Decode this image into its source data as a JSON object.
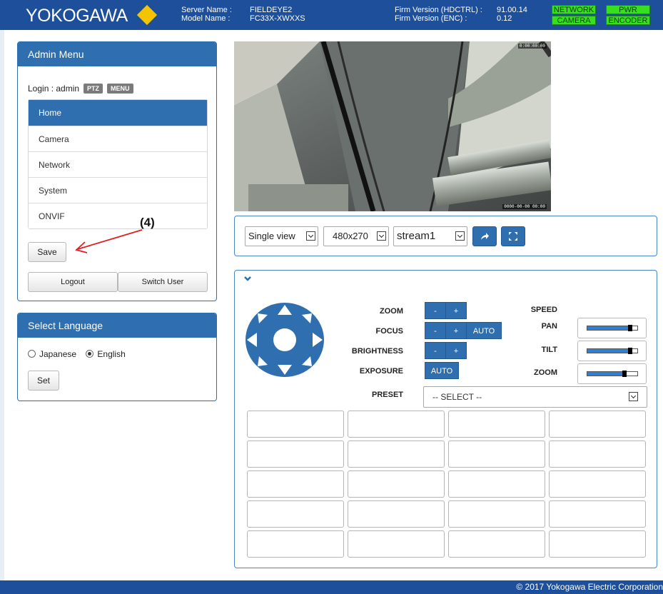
{
  "header": {
    "brand": "YOKOGAWA",
    "server_name_label": "Server Name :",
    "server_name": "FIELDEYE2",
    "model_name_label": "Model Name :",
    "model_name": "FC33X-XWXXS",
    "firm_hdctrl_label": "Firm Version (HDCTRL) :",
    "firm_hdctrl": "91.00.14",
    "firm_enc_label": "Firm Version (ENC) :",
    "firm_enc": "0.12",
    "status_leds": [
      "NETWORK",
      "PWR",
      "CAMERA",
      "ENCODER"
    ],
    "led_color": "#37e01f"
  },
  "admin_menu": {
    "title": "Admin Menu",
    "login_text": "Login : admin",
    "tags": [
      "PTZ",
      "MENU"
    ],
    "nav": [
      {
        "label": "Home",
        "active": true
      },
      {
        "label": "Camera"
      },
      {
        "label": "Network"
      },
      {
        "label": "System"
      },
      {
        "label": "ONVIF"
      }
    ],
    "save_label": "Save",
    "logout_label": "Logout",
    "switch_user_label": "Switch User"
  },
  "annotation": {
    "label": "(4)",
    "color": "#e02020"
  },
  "language": {
    "title": "Select Language",
    "options": [
      "Japanese",
      "English"
    ],
    "selected": "English",
    "set_label": "Set"
  },
  "video": {
    "timestamp_top": "0:00:00:00",
    "timestamp_bottom": "0000-00-00 00:00"
  },
  "stream": {
    "view_mode": "Single view",
    "resolution": "480x270",
    "stream": "stream1",
    "icons": [
      "arrow-redirect-icon",
      "fullscreen-icon"
    ]
  },
  "ptz": {
    "zoom_label": "ZOOM",
    "focus_label": "FOCUS",
    "brightness_label": "BRIGHTNESS",
    "exposure_label": "EXPOSURE",
    "minus_label": "-",
    "plus_label": "+",
    "auto_label": "AUTO",
    "speed_label": "SPEED",
    "speed": [
      {
        "label": "PAN",
        "value": 0.82
      },
      {
        "label": "TILT",
        "value": 0.82
      },
      {
        "label": "ZOOM",
        "value": 0.7
      }
    ],
    "preset_label": "PRESET",
    "preset_value": "-- SELECT --"
  },
  "footer": {
    "copyright": "© 2017 Yokogawa Electric Corporation"
  },
  "colors": {
    "header": "#1d4f9a",
    "accent": "#2f6fb0",
    "brand_mark": "#f4c400"
  }
}
